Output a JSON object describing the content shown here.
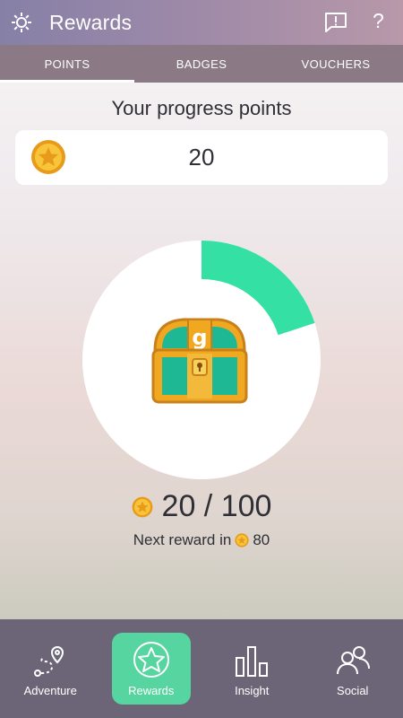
{
  "header": {
    "title": "Rewards"
  },
  "tabs": [
    {
      "label": "POINTS",
      "active": true
    },
    {
      "label": "BADGES",
      "active": false
    },
    {
      "label": "VOUCHERS",
      "active": false
    }
  ],
  "progress": {
    "heading": "Your progress points",
    "points_value": "20",
    "fraction_text": "20 / 100",
    "next_reward_prefix": "Next reward in",
    "next_reward_value": "80",
    "fill_fraction": 0.2,
    "ring_color": "#35e0a4"
  },
  "nav": [
    {
      "label": "Adventure",
      "icon": "map-route-icon"
    },
    {
      "label": "Rewards",
      "icon": "star-icon",
      "active": true
    },
    {
      "label": "Insight",
      "icon": "bar-chart-icon"
    },
    {
      "label": "Social",
      "icon": "people-icon"
    }
  ],
  "colors": {
    "accent": "#56d5a0",
    "nav_bg": "#6c6577",
    "tab_bg": "#8b7a86"
  }
}
